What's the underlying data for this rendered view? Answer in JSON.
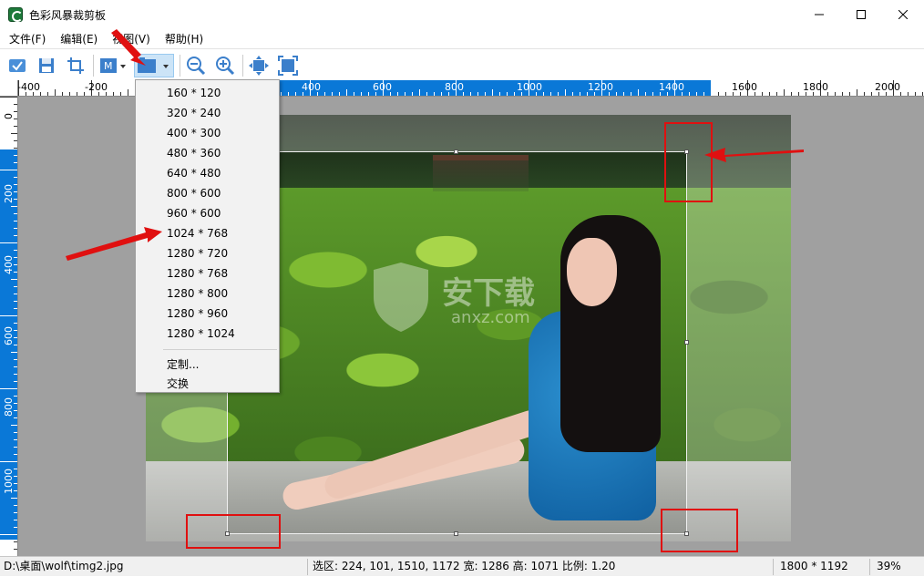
{
  "window": {
    "title": "色彩风暴裁剪板",
    "minimize_icon": "minimize-icon",
    "maximize_icon": "maximize-icon",
    "close_icon": "close-icon"
  },
  "menu": [
    "文件(F)",
    "编辑(E)",
    "视图(V)",
    "帮助(H)"
  ],
  "toolbar": {
    "icons": [
      "check-icon",
      "save-icon",
      "crop-icon",
      "mode-icon",
      "size-preset-icon",
      "zoom-out-icon",
      "zoom-in-icon",
      "fit-icon",
      "fullscreen-icon"
    ]
  },
  "ruler": {
    "h_labels": [
      "-400",
      "-200",
      "400",
      "600",
      "800",
      "1000",
      "1200",
      "1400",
      "1600",
      "1800",
      "2000"
    ],
    "v_labels": [
      "0",
      "200",
      "400",
      "600",
      "800",
      "1000"
    ]
  },
  "dropdown": {
    "items": [
      "160 * 120",
      "320 * 240",
      "400 * 300",
      "480 * 360",
      "640 * 480",
      "800 * 600",
      "960 * 600",
      "1024 * 768",
      "1280 * 720",
      "1280 * 768",
      "1280 * 800",
      "1280 * 960",
      "1280 * 1024"
    ],
    "custom": "定制...",
    "swap": "交换"
  },
  "watermark": {
    "text": "安下载",
    "sub": "anxz.com"
  },
  "status": {
    "path": "D:\\桌面\\wolf\\timg2.jpg",
    "selection": "选区: 224, 101, 1510, 1172 宽: 1286 高: 1071 比例: 1.20",
    "image_size": "1800 * 1192",
    "zoom": "39%"
  },
  "colors": {
    "accent": "#0a78d7",
    "annotation_red": "#e01010"
  }
}
